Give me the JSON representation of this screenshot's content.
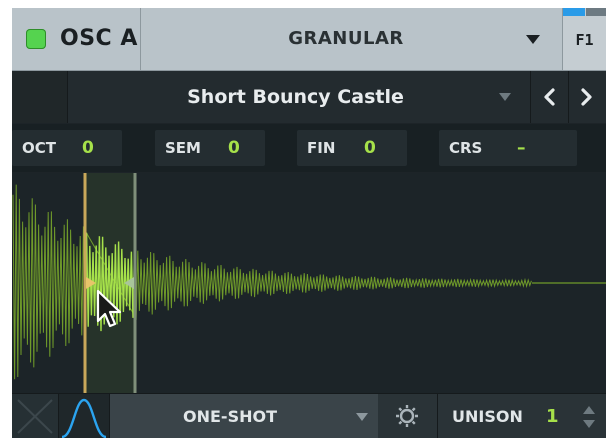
{
  "osc": {
    "label": "OSC A",
    "enabled": true,
    "enabled_color": "#55d34f",
    "wavetable": "GRANULAR",
    "filter_button": "F1"
  },
  "preset": {
    "name": "Short Bouncy Castle",
    "prev_icon": "chevron-left-icon",
    "next_icon": "chevron-right-icon"
  },
  "tuning": [
    {
      "name": "OCT",
      "value": "0"
    },
    {
      "name": "SEM",
      "value": "0"
    },
    {
      "name": "FIN",
      "value": "0"
    },
    {
      "name": "CRS",
      "value": "–"
    }
  ],
  "waveform": {
    "color": "#6f9a2a",
    "highlight_color": "#a6e14a"
  },
  "bottom": {
    "mode": "ONE-SHOT",
    "unison_label": "UNISON",
    "unison_value": "1"
  },
  "accent_color": "#a6e14a"
}
